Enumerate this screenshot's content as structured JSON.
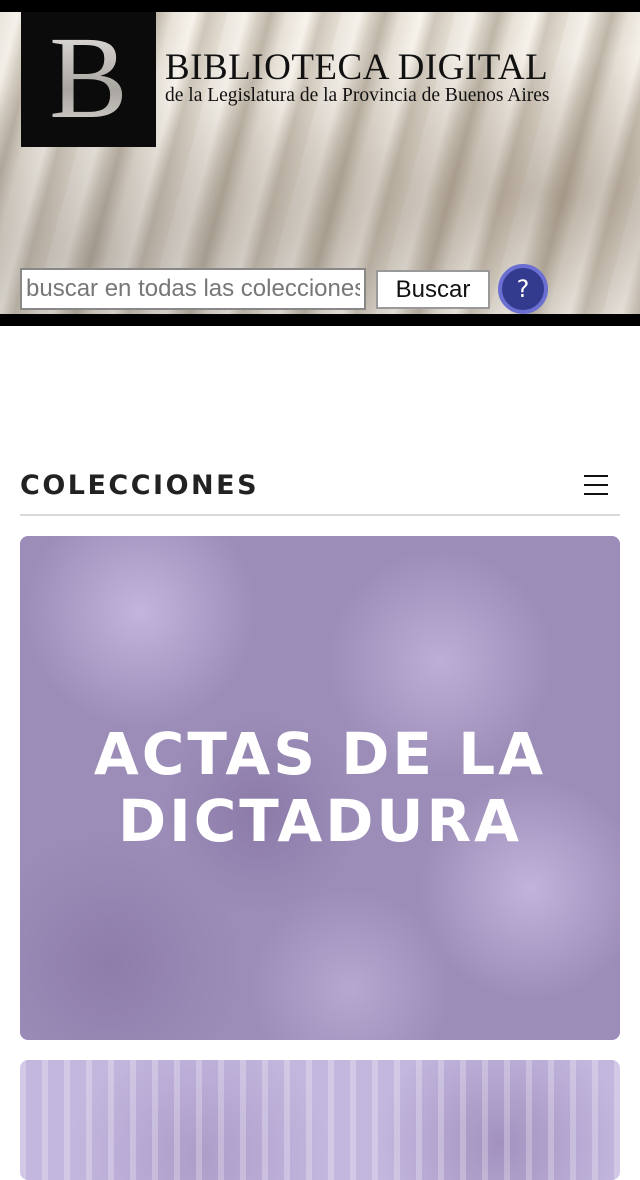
{
  "header": {
    "logo_letter": "B",
    "title": "BIBLIOTECA DIGITAL",
    "subtitle": "de la Legislatura de la Provincia de Buenos Aires"
  },
  "search": {
    "placeholder": "buscar en todas las colecciones",
    "button_label": "Buscar",
    "help_label": "?"
  },
  "collections": {
    "section_title": "COLECCIONES",
    "menu_icon": "hamburger-menu-icon",
    "cards": [
      {
        "title": "ACTAS DE LA DICTADURA",
        "color": "#9c8db8"
      },
      {
        "title": "",
        "color": "#c3b7de"
      }
    ]
  },
  "colors": {
    "help_button": "#333b8f",
    "help_button_ring": "#6b6fd1"
  }
}
